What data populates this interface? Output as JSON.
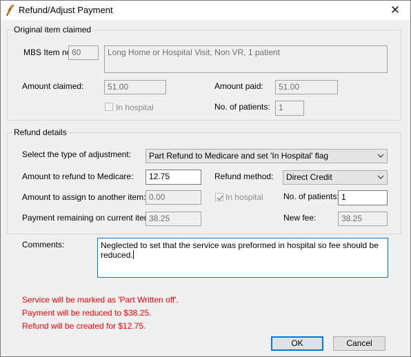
{
  "window": {
    "title": "Refund/Adjust Payment",
    "close_glyph": "✕"
  },
  "original": {
    "group_label": "Original item claimed",
    "mbs_label": "MBS Item no:",
    "mbs_value": "60",
    "description": "Long Home or Hospital Visit, Non VR, 1 patient",
    "amount_claimed_label": "Amount claimed:",
    "amount_claimed_value": "51.00",
    "amount_paid_label": "Amount paid:",
    "amount_paid_value": "51.00",
    "in_hospital_label": "In hospital",
    "in_hospital_checked": false,
    "patients_label": "No. of patients:",
    "patients_value": "1"
  },
  "refund": {
    "group_label": "Refund details",
    "adjustment_type_label": "Select the type of adjustment:",
    "adjustment_type_value": "Part Refund to Medicare and set 'In Hospital' flag",
    "refund_amount_label": "Amount to refund to Medicare:",
    "refund_amount_value": "12.75",
    "refund_method_label": "Refund method:",
    "refund_method_value": "Direct Credit",
    "assign_label": "Amount to assign to another item:",
    "assign_value": "0.00",
    "in_hospital_label": "In hospital",
    "in_hospital_checked": true,
    "patients_label": "No. of patients:",
    "patients_value": "1",
    "remaining_label": "Payment remaining on current item:",
    "remaining_value": "38.25",
    "new_fee_label": "New fee:",
    "new_fee_value": "38.25"
  },
  "comments": {
    "label": "Comments:",
    "value": "Neglected to set that the service was preformed in hospital so fee should be reduced."
  },
  "messages": [
    "Service will be marked as 'Part Written off'.",
    "Payment will be reduced to $38.25.",
    "Refund will be created for $12.75."
  ],
  "buttons": {
    "ok": "OK",
    "cancel": "Cancel"
  },
  "icons": {
    "app": "quill-pen-icon",
    "close": "close-icon",
    "dropdown": "chevron-down-icon",
    "check": "checkmark-icon"
  },
  "colors": {
    "message_red": "#ff0000",
    "focus_blue": "#0078d7"
  }
}
